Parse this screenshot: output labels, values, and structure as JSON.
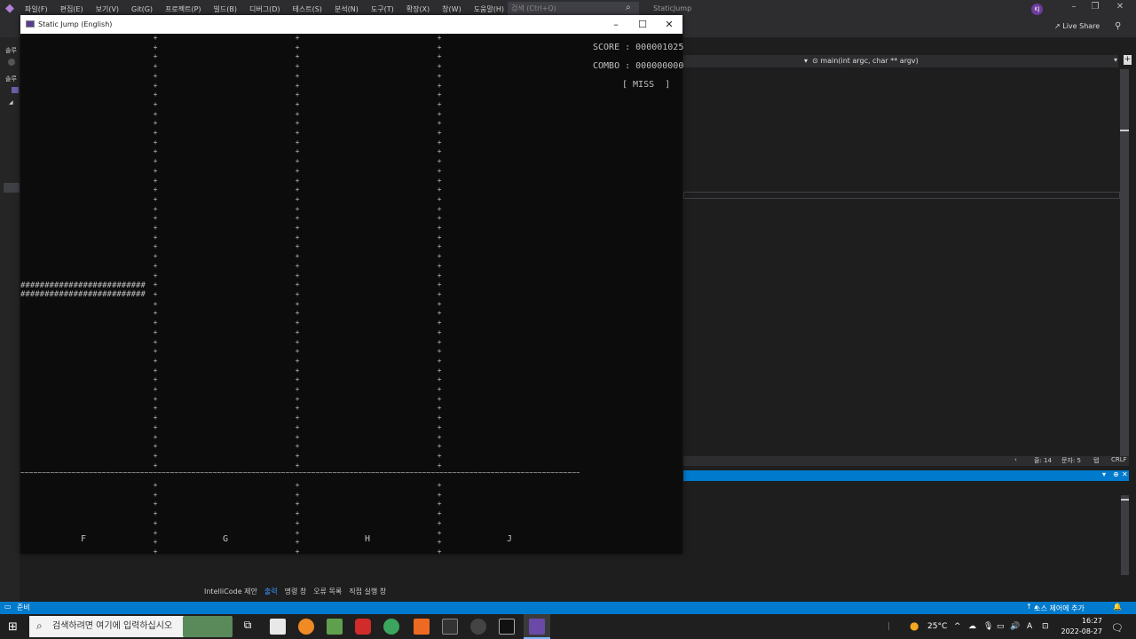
{
  "menu": {
    "items": [
      "파일(F)",
      "편집(E)",
      "보기(V)",
      "Git(G)",
      "프로젝트(P)",
      "빌드(B)",
      "디버그(D)",
      "테스트(S)",
      "분석(N)",
      "도구(T)",
      "확장(X)",
      "창(W)",
      "도움말(H)"
    ],
    "search_placeholder": "검색 (Ctrl+Q)",
    "app_name": "StaticJump",
    "avatar_initials": "KJ"
  },
  "toolbar": {
    "live_share": "Live Share"
  },
  "leftstrip": {
    "label1": "솔루",
    "label2": "솔루"
  },
  "editor": {
    "function_dropdown": "main(int argc, char ** argv)",
    "status": {
      "line": "줄: 14",
      "char": "문자: 5",
      "tab": "탭",
      "eol": "CRLF"
    }
  },
  "bottom_tabs": [
    "IntelliCode 제안",
    "출력",
    "명령 창",
    "오류 목록",
    "직접 실행 창"
  ],
  "vs_status": {
    "ready": "준비",
    "source_control": "소스 제어에 추가"
  },
  "console": {
    "title": "Static Jump (English)",
    "score": "SCORE : 000001025",
    "combo": "COMBO : 000000000",
    "judge": "[ MISS  ]",
    "note_row": "##########################",
    "judge_line_char": "~",
    "lane_char": "+",
    "lanes": [
      "F",
      "G",
      "H",
      "J"
    ]
  },
  "taskbar": {
    "search_placeholder": "검색하려면 여기에 입력하십시오",
    "weather": "25°C",
    "time": "16:27",
    "date": "2022-08-27",
    "ime": "A"
  },
  "colors": {
    "accent": "#007acc",
    "console_bg": "#0c0c0c",
    "vs_bg": "#1e1e1e"
  }
}
